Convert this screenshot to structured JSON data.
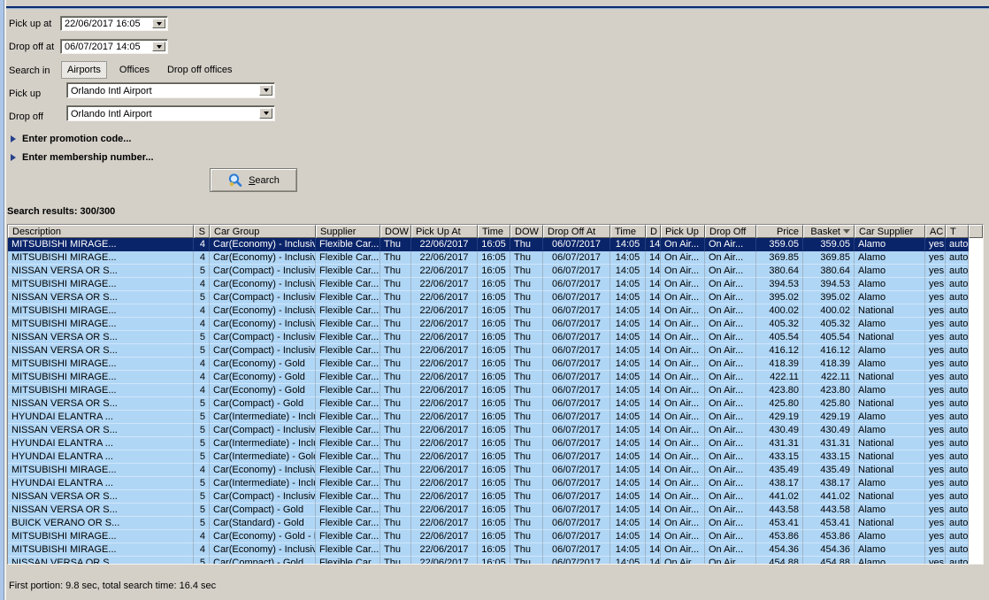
{
  "colors": {
    "window_bg": "#D4D0C8",
    "accent_line": "#0A2C6E",
    "left_strip": "#ABC6E8",
    "header_bg": "#D4D0C8",
    "row_bg": "#B0D6F5",
    "selected_row_bg": "#0A246A",
    "expander_arrow": "#27408B"
  },
  "form": {
    "pickup_at": {
      "label": "Pick up at",
      "value": "22/06/2017 16:05"
    },
    "dropoff_at": {
      "label": "Drop off at",
      "value": "06/07/2017 14:05"
    },
    "search_in": {
      "label": "Search in",
      "tabs": [
        {
          "label": "Airports",
          "selected": true
        },
        {
          "label": "Offices",
          "selected": false
        },
        {
          "label": "Drop off offices",
          "selected": false
        }
      ]
    },
    "pickup": {
      "label": "Pick up",
      "value": "Orlando Intl Airport"
    },
    "dropoff": {
      "label": "Drop off",
      "value": "Orlando Intl Airport"
    },
    "promo_expander": "Enter promotion code...",
    "membership_expander": "Enter membership number...",
    "search_button": {
      "mnemonic": "S",
      "rest": "earch"
    }
  },
  "results": {
    "summary": "Search results: 300/300",
    "status": "First portion: 9.8 sec, total search time: 16.4 sec",
    "sort_column": "Basket",
    "selected_row": 0,
    "clipped_last_row": true,
    "columns": [
      "Description",
      "S",
      "Car Group",
      "Supplier",
      "DOW",
      "Pick Up At",
      "Time",
      "DOW",
      "Drop Off At",
      "Time",
      "D",
      "Pick Up",
      "Drop Off",
      "Price",
      "Basket",
      "Car Supplier",
      "AC",
      "T"
    ],
    "rows": [
      [
        "MITSUBISHI MIRAGE...",
        "4",
        "Car(Economy) - Inclusive",
        "Flexible Car...",
        "Thu",
        "22/06/2017",
        "16:05",
        "Thu",
        "06/07/2017",
        "14:05",
        "14",
        "On Air...",
        "On Air...",
        "359.05",
        "359.05",
        "Alamo",
        "yes",
        "auto"
      ],
      [
        "MITSUBISHI MIRAGE...",
        "4",
        "Car(Economy) - Inclusive",
        "Flexible Car...",
        "Thu",
        "22/06/2017",
        "16:05",
        "Thu",
        "06/07/2017",
        "14:05",
        "14",
        "On Air...",
        "On Air...",
        "369.85",
        "369.85",
        "Alamo",
        "yes",
        "auto"
      ],
      [
        "NISSAN VERSA OR S...",
        "5",
        "Car(Compact) - Inclusive",
        "Flexible Car...",
        "Thu",
        "22/06/2017",
        "16:05",
        "Thu",
        "06/07/2017",
        "14:05",
        "14",
        "On Air...",
        "On Air...",
        "380.64",
        "380.64",
        "Alamo",
        "yes",
        "auto"
      ],
      [
        "MITSUBISHI MIRAGE...",
        "4",
        "Car(Economy) - Inclusive - Plus Exces...",
        "Flexible Car...",
        "Thu",
        "22/06/2017",
        "16:05",
        "Thu",
        "06/07/2017",
        "14:05",
        "14",
        "On Air...",
        "On Air...",
        "394.53",
        "394.53",
        "Alamo",
        "yes",
        "auto"
      ],
      [
        "NISSAN VERSA OR S...",
        "5",
        "Car(Compact) - Inclusive",
        "Flexible Car...",
        "Thu",
        "22/06/2017",
        "16:05",
        "Thu",
        "06/07/2017",
        "14:05",
        "14",
        "On Air...",
        "On Air...",
        "395.02",
        "395.02",
        "Alamo",
        "yes",
        "auto"
      ],
      [
        "MITSUBISHI MIRAGE...",
        "4",
        "Car(Economy) - Inclusive",
        "Flexible Car...",
        "Thu",
        "22/06/2017",
        "16:05",
        "Thu",
        "06/07/2017",
        "14:05",
        "14",
        "On Air...",
        "On Air...",
        "400.02",
        "400.02",
        "National",
        "yes",
        "auto"
      ],
      [
        "MITSUBISHI MIRAGE...",
        "4",
        "Car(Economy) - Inclusive - Plus Exces...",
        "Flexible Car...",
        "Thu",
        "22/06/2017",
        "16:05",
        "Thu",
        "06/07/2017",
        "14:05",
        "14",
        "On Air...",
        "On Air...",
        "405.32",
        "405.32",
        "Alamo",
        "yes",
        "auto"
      ],
      [
        "NISSAN VERSA OR S...",
        "5",
        "Car(Compact) - Inclusive",
        "Flexible Car...",
        "Thu",
        "22/06/2017",
        "16:05",
        "Thu",
        "06/07/2017",
        "14:05",
        "14",
        "On Air...",
        "On Air...",
        "405.54",
        "405.54",
        "National",
        "yes",
        "auto"
      ],
      [
        "NISSAN VERSA OR S...",
        "5",
        "Car(Compact) - Inclusive - Plus Exces...",
        "Flexible Car...",
        "Thu",
        "22/06/2017",
        "16:05",
        "Thu",
        "06/07/2017",
        "14:05",
        "14",
        "On Air...",
        "On Air...",
        "416.12",
        "416.12",
        "Alamo",
        "yes",
        "auto"
      ],
      [
        "MITSUBISHI MIRAGE...",
        "4",
        "Car(Economy) - Gold",
        "Flexible Car...",
        "Thu",
        "22/06/2017",
        "16:05",
        "Thu",
        "06/07/2017",
        "14:05",
        "14",
        "On Air...",
        "On Air...",
        "418.39",
        "418.39",
        "Alamo",
        "yes",
        "auto"
      ],
      [
        "MITSUBISHI MIRAGE...",
        "4",
        "Car(Economy) - Gold",
        "Flexible Car...",
        "Thu",
        "22/06/2017",
        "16:05",
        "Thu",
        "06/07/2017",
        "14:05",
        "14",
        "On Air...",
        "On Air...",
        "422.11",
        "422.11",
        "National",
        "yes",
        "auto"
      ],
      [
        "MITSUBISHI MIRAGE...",
        "4",
        "Car(Economy) - Gold",
        "Flexible Car...",
        "Thu",
        "22/06/2017",
        "16:05",
        "Thu",
        "06/07/2017",
        "14:05",
        "14",
        "On Air...",
        "On Air...",
        "423.80",
        "423.80",
        "Alamo",
        "yes",
        "auto"
      ],
      [
        "NISSAN VERSA OR S...",
        "5",
        "Car(Compact) - Gold",
        "Flexible Car...",
        "Thu",
        "22/06/2017",
        "16:05",
        "Thu",
        "06/07/2017",
        "14:05",
        "14",
        "On Air...",
        "On Air...",
        "425.80",
        "425.80",
        "National",
        "yes",
        "auto"
      ],
      [
        "HYUNDAI ELANTRA ...",
        "5",
        "Car(Intermediate) - Inclusive",
        "Flexible Car...",
        "Thu",
        "22/06/2017",
        "16:05",
        "Thu",
        "06/07/2017",
        "14:05",
        "14",
        "On Air...",
        "On Air...",
        "429.19",
        "429.19",
        "Alamo",
        "yes",
        "auto"
      ],
      [
        "NISSAN VERSA OR S...",
        "5",
        "Car(Compact) - Inclusive - Plus Exces...",
        "Flexible Car...",
        "Thu",
        "22/06/2017",
        "16:05",
        "Thu",
        "06/07/2017",
        "14:05",
        "14",
        "On Air...",
        "On Air...",
        "430.49",
        "430.49",
        "Alamo",
        "yes",
        "auto"
      ],
      [
        "HYUNDAI ELANTRA ...",
        "5",
        "Car(Intermediate) - Inclusive",
        "Flexible Car...",
        "Thu",
        "22/06/2017",
        "16:05",
        "Thu",
        "06/07/2017",
        "14:05",
        "14",
        "On Air...",
        "On Air...",
        "431.31",
        "431.31",
        "National",
        "yes",
        "auto"
      ],
      [
        "HYUNDAI ELANTRA ...",
        "5",
        "Car(Intermediate) - Gold",
        "Flexible Car...",
        "Thu",
        "22/06/2017",
        "16:05",
        "Thu",
        "06/07/2017",
        "14:05",
        "14",
        "On Air...",
        "On Air...",
        "433.15",
        "433.15",
        "National",
        "yes",
        "auto"
      ],
      [
        "MITSUBISHI MIRAGE...",
        "4",
        "Car(Economy) - Inclusive - Plus Exces...",
        "Flexible Car...",
        "Thu",
        "22/06/2017",
        "16:05",
        "Thu",
        "06/07/2017",
        "14:05",
        "14",
        "On Air...",
        "On Air...",
        "435.49",
        "435.49",
        "National",
        "yes",
        "auto"
      ],
      [
        "HYUNDAI ELANTRA ...",
        "5",
        "Car(Intermediate) - Inclusive",
        "Flexible Car...",
        "Thu",
        "22/06/2017",
        "16:05",
        "Thu",
        "06/07/2017",
        "14:05",
        "14",
        "On Air...",
        "On Air...",
        "438.17",
        "438.17",
        "Alamo",
        "yes",
        "auto"
      ],
      [
        "NISSAN VERSA OR S...",
        "5",
        "Car(Compact) - Inclusive - Plus Exces...",
        "Flexible Car...",
        "Thu",
        "22/06/2017",
        "16:05",
        "Thu",
        "06/07/2017",
        "14:05",
        "14",
        "On Air...",
        "On Air...",
        "441.02",
        "441.02",
        "National",
        "yes",
        "auto"
      ],
      [
        "NISSAN VERSA OR S...",
        "5",
        "Car(Compact) - Gold",
        "Flexible Car...",
        "Thu",
        "22/06/2017",
        "16:05",
        "Thu",
        "06/07/2017",
        "14:05",
        "14",
        "On Air...",
        "On Air...",
        "443.58",
        "443.58",
        "Alamo",
        "yes",
        "auto"
      ],
      [
        "BUICK VERANO OR S...",
        "5",
        "Car(Standard) - Gold",
        "Flexible Car...",
        "Thu",
        "22/06/2017",
        "16:05",
        "Thu",
        "06/07/2017",
        "14:05",
        "14",
        "On Air...",
        "On Air...",
        "453.41",
        "453.41",
        "National",
        "yes",
        "auto"
      ],
      [
        "MITSUBISHI MIRAGE...",
        "4",
        "Car(Economy) - Gold - Plus Excess Re...",
        "Flexible Car...",
        "Thu",
        "22/06/2017",
        "16:05",
        "Thu",
        "06/07/2017",
        "14:05",
        "14",
        "On Air...",
        "On Air...",
        "453.86",
        "453.86",
        "Alamo",
        "yes",
        "auto"
      ],
      [
        "MITSUBISHI MIRAGE...",
        "4",
        "Car(Economy) - Inclusive GPS",
        "Flexible Car...",
        "Thu",
        "22/06/2017",
        "16:05",
        "Thu",
        "06/07/2017",
        "14:05",
        "14",
        "On Air...",
        "On Air...",
        "454.36",
        "454.36",
        "Alamo",
        "yes",
        "auto"
      ],
      [
        "NISSAN VERSA OR S...",
        "5",
        "Car(Compact) - Gold",
        "Flexible Car...",
        "Thu",
        "22/06/2017",
        "16:05",
        "Thu",
        "06/07/2017",
        "14:05",
        "14",
        "On Air...",
        "On Air...",
        "454.88",
        "454.88",
        "Alamo",
        "yes",
        "auto"
      ]
    ]
  }
}
